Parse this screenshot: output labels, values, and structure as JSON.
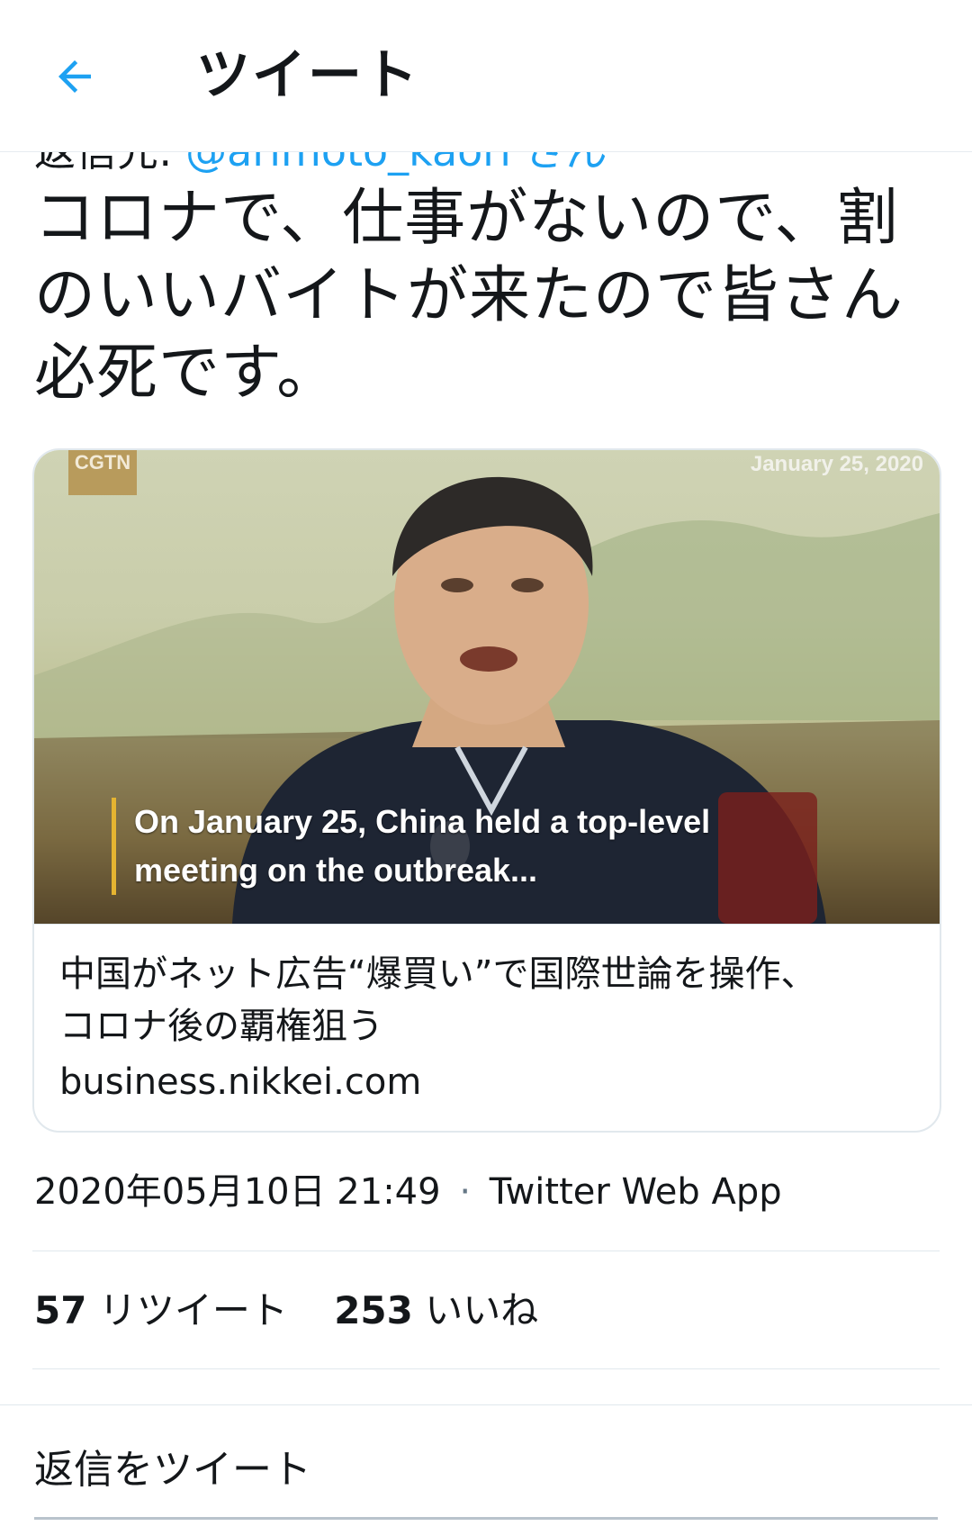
{
  "header": {
    "back_icon": "arrow-left-icon",
    "title": "ツイート",
    "accent_color": "#1da1f2"
  },
  "reply_to": {
    "prefix": "返信先:",
    "handle": "@arimoto_kaori さん"
  },
  "tweet": {
    "text": "コロナで、仕事がないので、割のいいバイトが来たので皆さん必死です。"
  },
  "card": {
    "media": {
      "logo": "CGTN",
      "date": "January 25, 2020",
      "caption_line1": "On January 25, China held a top-level",
      "caption_line2": "meeting on the outbreak..."
    },
    "title_line1": "中国がネット広告“爆買い”で国際世論を操作、",
    "title_line2": "コロナ後の覇権狙う",
    "domain": "business.nikkei.com"
  },
  "meta": {
    "timestamp": "2020年05月10日 21:49",
    "separator": "·",
    "source": "Twitter Web App"
  },
  "stats": {
    "retweets_count": "57",
    "retweets_label": "リツイート",
    "likes_count": "253",
    "likes_label": "いいね"
  },
  "reply": {
    "placeholder": "返信をツイート"
  }
}
